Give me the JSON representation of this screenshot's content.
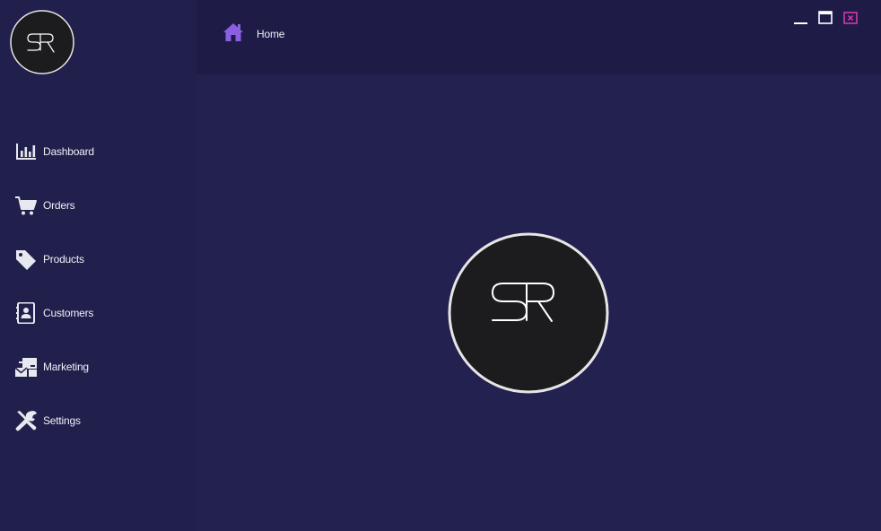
{
  "app": {
    "logo_text": "SR",
    "accent_color": "#8a5fe0",
    "close_color": "#e03ab0"
  },
  "sidebar": {
    "items": [
      {
        "label": "Dashboard",
        "icon": "bar-chart-icon"
      },
      {
        "label": "Orders",
        "icon": "shopping-cart-icon"
      },
      {
        "label": "Products",
        "icon": "tag-icon"
      },
      {
        "label": "Customers",
        "icon": "address-book-icon"
      },
      {
        "label": "Marketing",
        "icon": "mail-bulk-icon"
      },
      {
        "label": "Settings",
        "icon": "tools-icon"
      }
    ]
  },
  "header": {
    "title": "Home",
    "icon": "home-icon"
  },
  "window_controls": {
    "minimize": "minimize-icon",
    "maximize": "maximize-icon",
    "close": "close-icon"
  }
}
